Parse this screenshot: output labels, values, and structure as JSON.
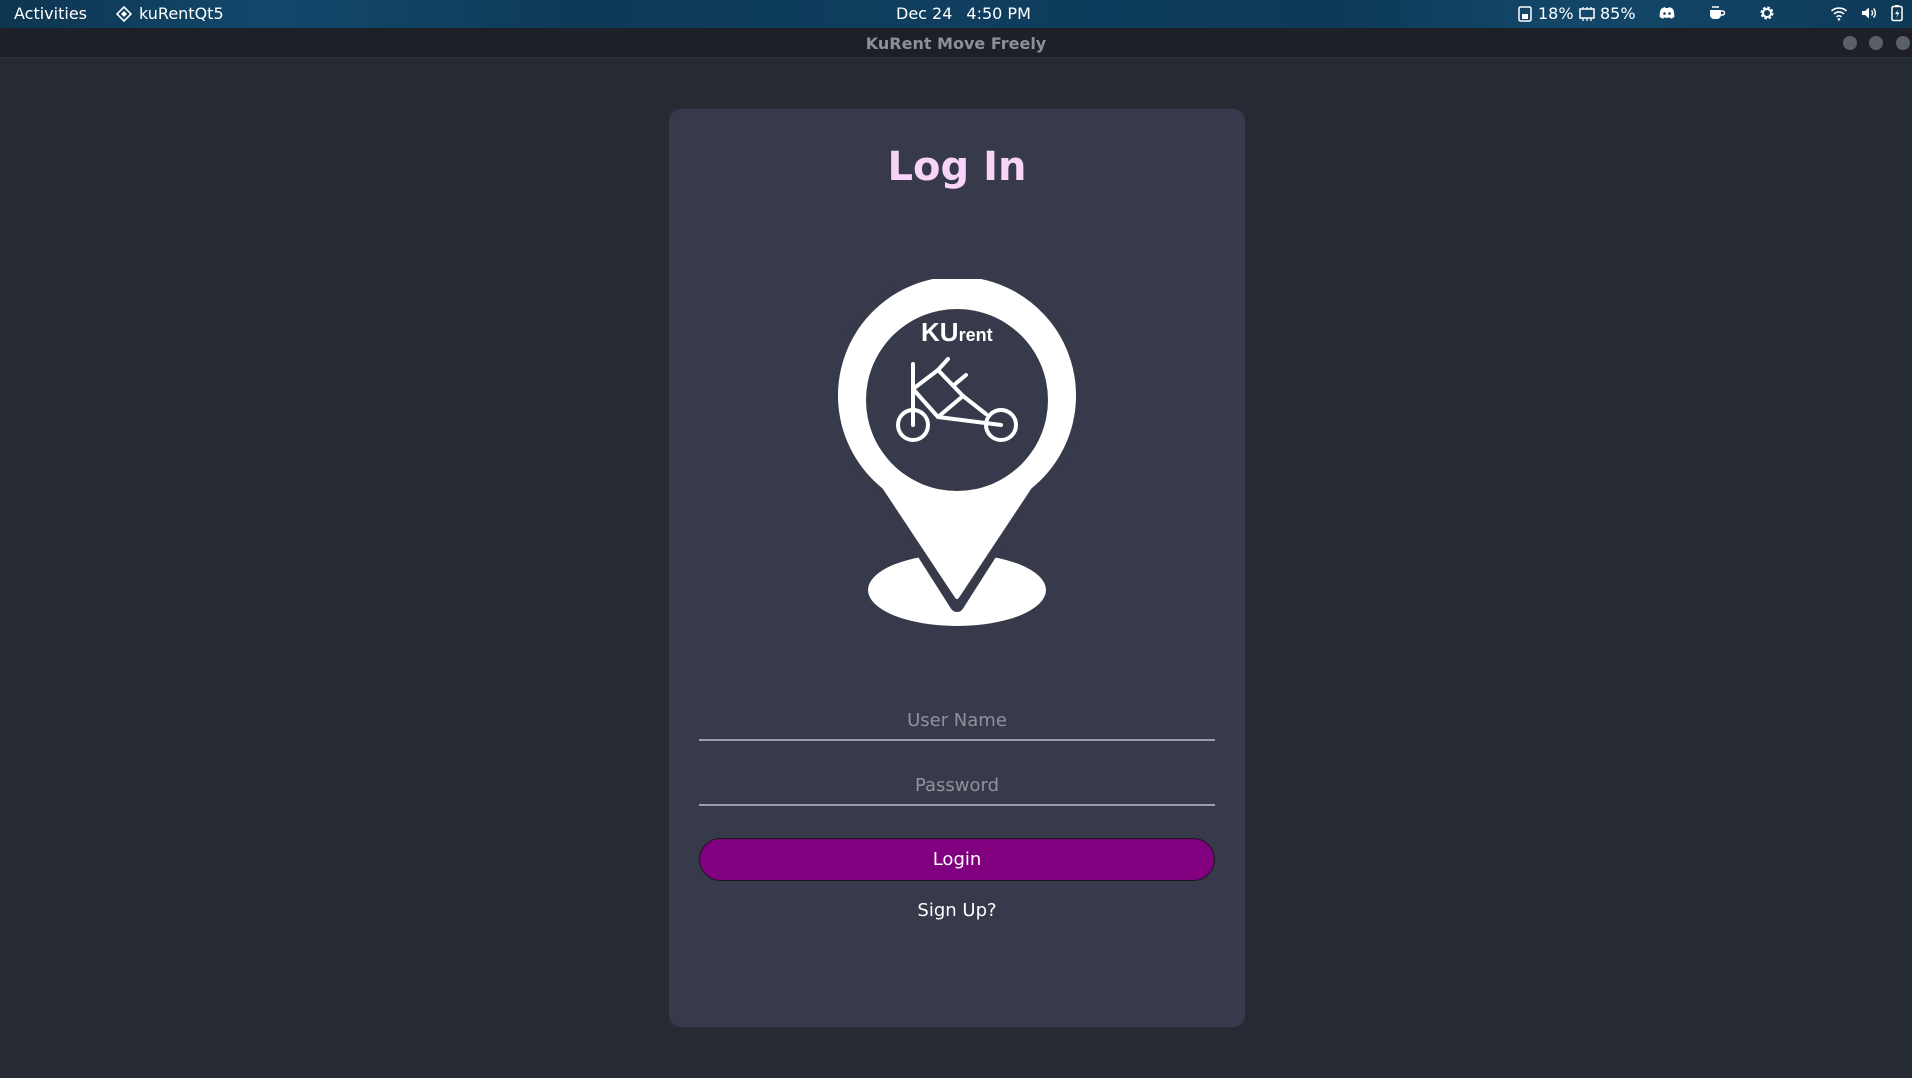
{
  "topbar": {
    "activities": "Activities",
    "app_name": "kuRentQt5",
    "date": "Dec 24",
    "time": "4:50 PM",
    "disk_usage": "18%",
    "memory_usage": "85%",
    "icons": [
      "disk-icon",
      "memory-icon",
      "discord-icon",
      "coffee-icon",
      "gear-icon",
      "wifi-icon",
      "volume-icon",
      "battery-icon"
    ]
  },
  "window": {
    "title": "KuRent Move Freely"
  },
  "login": {
    "heading": "Log In",
    "logo_text_main": "KU",
    "logo_text_sub": "rent",
    "username_placeholder": "User Name",
    "password_placeholder": "Password",
    "login_label": "Login",
    "signup_label": "Sign Up?"
  },
  "colors": {
    "background": "#262a33",
    "card": "#363a4a",
    "heading": "#f8d4f8",
    "button": "#800080"
  }
}
